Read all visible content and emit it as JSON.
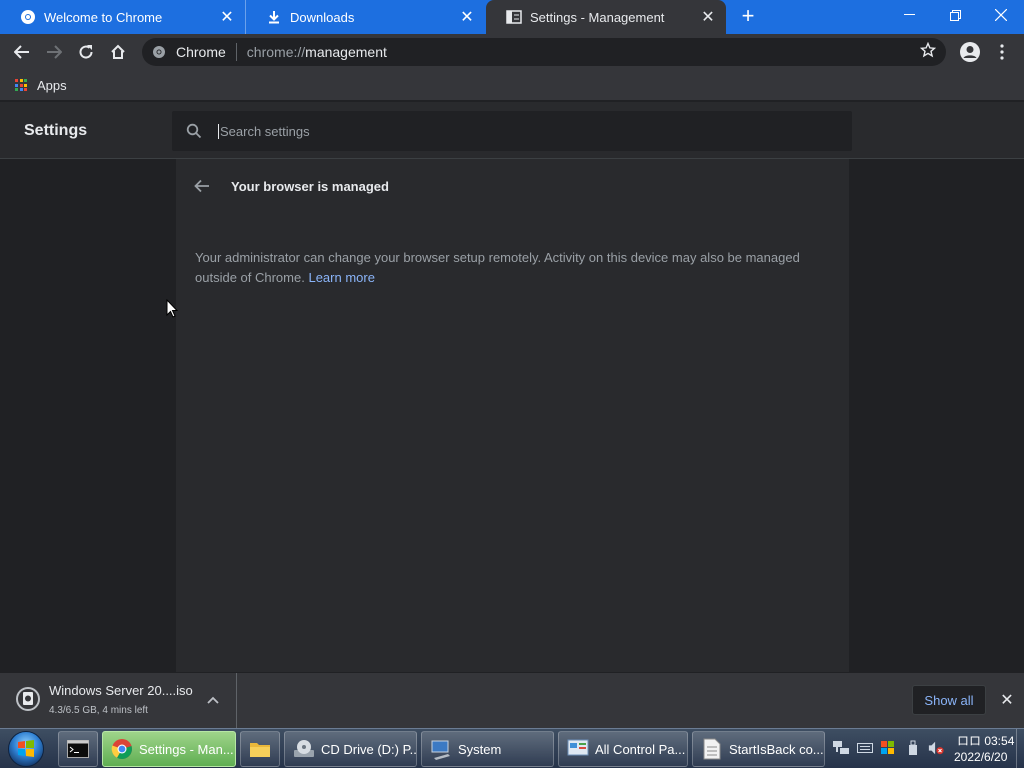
{
  "tabs": [
    {
      "title": "Welcome to Chrome",
      "icon": "chrome-icon"
    },
    {
      "title": "Downloads",
      "icon": "download-icon"
    },
    {
      "title": "Settings - Management",
      "icon": "settings-page-icon"
    }
  ],
  "toolbar": {
    "chip": "Chrome",
    "url_scheme": "chrome://",
    "url_path": "management"
  },
  "bookmarks": {
    "apps_label": "Apps"
  },
  "settings": {
    "title": "Settings",
    "search_placeholder": "Search settings"
  },
  "management": {
    "title": "Your browser is managed",
    "description": "Your administrator can change your browser setup remotely. Activity on this device may also be managed outside of Chrome.",
    "learn_more": "Learn more"
  },
  "download_shelf": {
    "file_name": "Windows Server 20....iso",
    "status": "4.3/6.5 GB, 4 mins left",
    "show_all": "Show all"
  },
  "taskbar": {
    "items": [
      {
        "label": "",
        "icon": "cmd-icon"
      },
      {
        "label": "Settings - Man...",
        "icon": "chrome-icon"
      },
      {
        "label": "",
        "icon": "folder-icon"
      },
      {
        "label": "CD Drive (D:) P...",
        "icon": "cd-drive-icon"
      },
      {
        "label": "System",
        "icon": "system-icon"
      },
      {
        "label": "All Control Pa...",
        "icon": "control-panel-icon"
      },
      {
        "label": "StartIsBack co...",
        "icon": "document-icon"
      }
    ],
    "clock_time": "ロロ 03:54",
    "clock_date": "2022/6/20"
  },
  "colors": {
    "tab_strip": "#1d6fe0",
    "toolbar": "#35363a",
    "link": "#8ab4f8",
    "page_bg": "#202124",
    "card_bg": "#292a2d"
  }
}
